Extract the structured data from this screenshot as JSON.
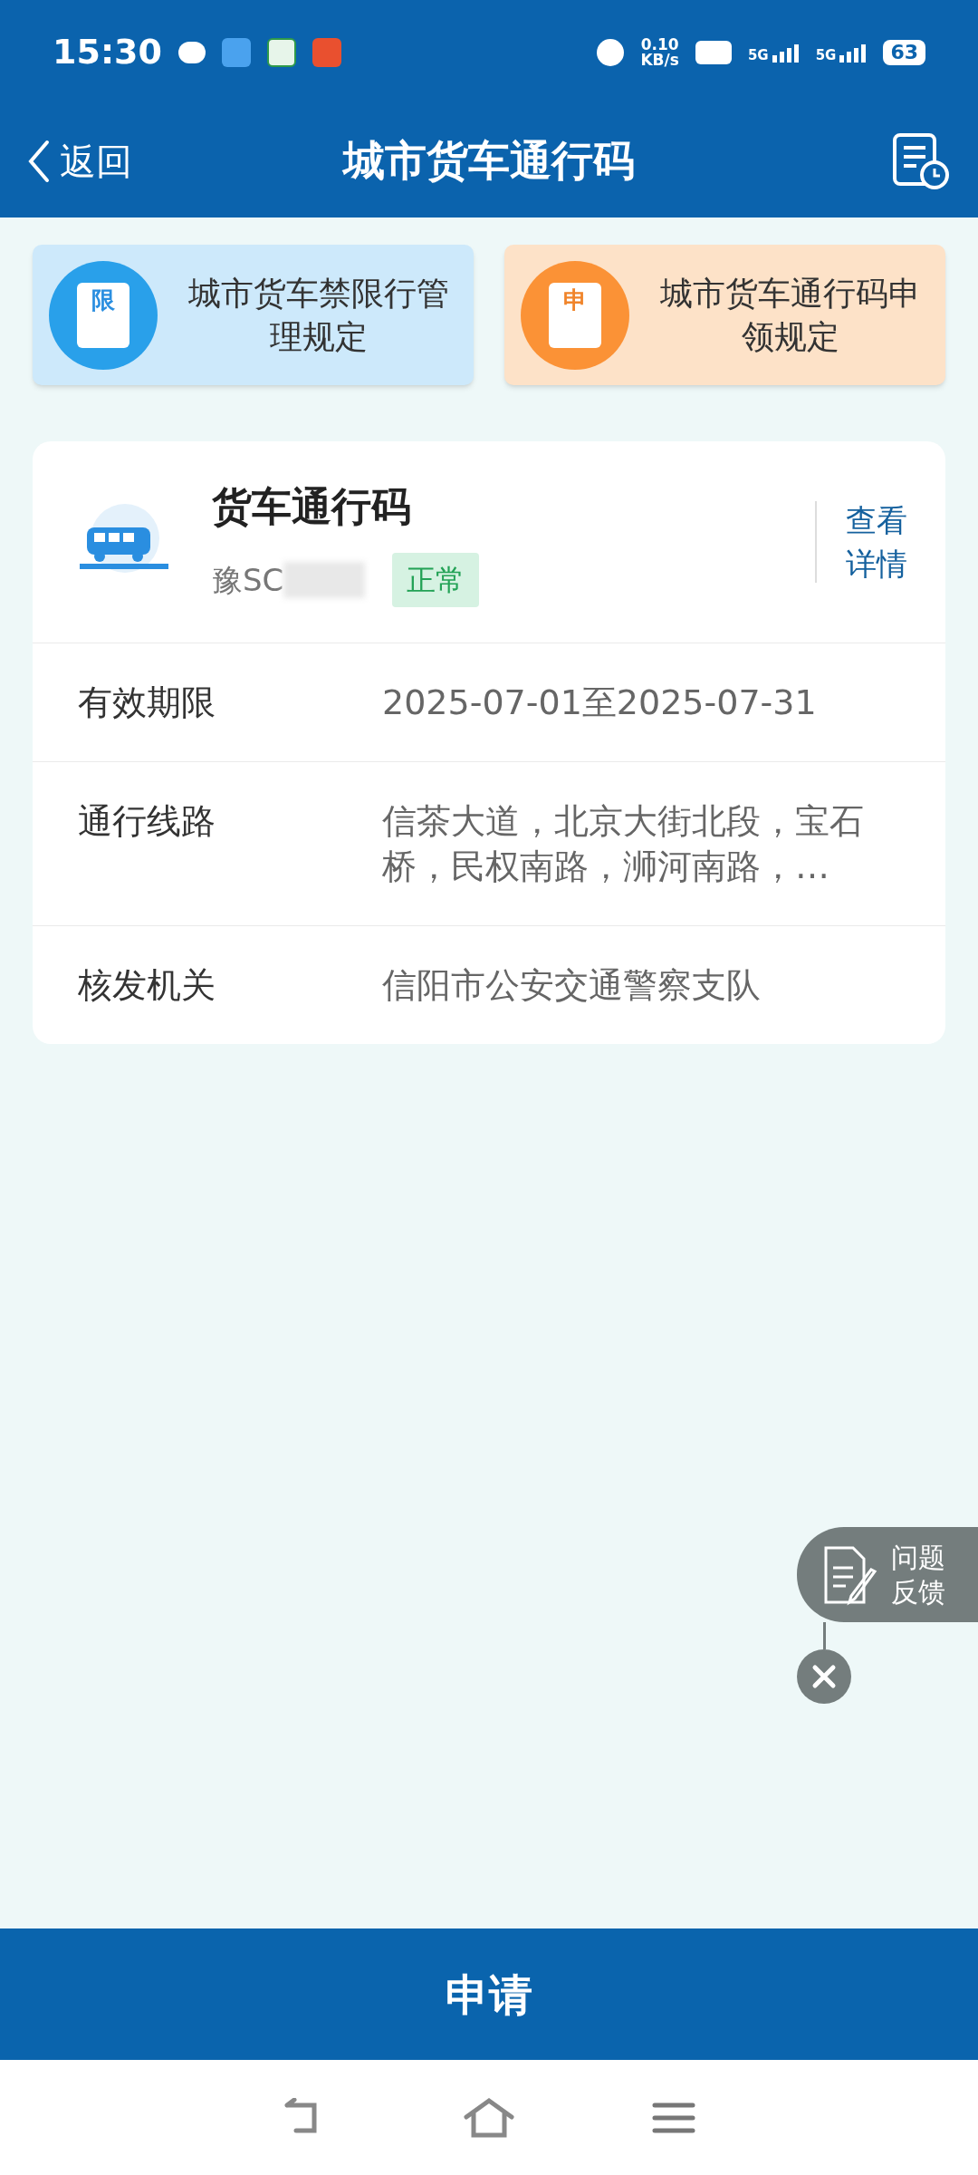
{
  "status_bar": {
    "time": "15:30",
    "speed": "0.10",
    "speed_unit": "KB/s",
    "network_1": "5G",
    "network_2": "5G",
    "battery": "63"
  },
  "header": {
    "back": "返回",
    "title": "城市货车通行码"
  },
  "shortcuts": [
    {
      "icon_text": "限",
      "label": "城市货车禁限行管理规定",
      "kind": "blue"
    },
    {
      "icon_text": "申",
      "label": "城市货车通行码申领规定",
      "kind": "orange"
    }
  ],
  "pass_card": {
    "title": "货车通行码",
    "plate": "豫SC",
    "status": "正常",
    "details_link": "查看详情",
    "rows": [
      {
        "label": "有效期限",
        "value": "2025-07-01至2025-07-31"
      },
      {
        "label": "通行线路",
        "value": "信茶大道，北京大街北段，宝石桥，民权南路，浉河南路，…"
      },
      {
        "label": "核发机关",
        "value": "信阳市公安交通警察支队"
      }
    ]
  },
  "feedback": {
    "label": "问题反馈"
  },
  "apply_button": "申请"
}
